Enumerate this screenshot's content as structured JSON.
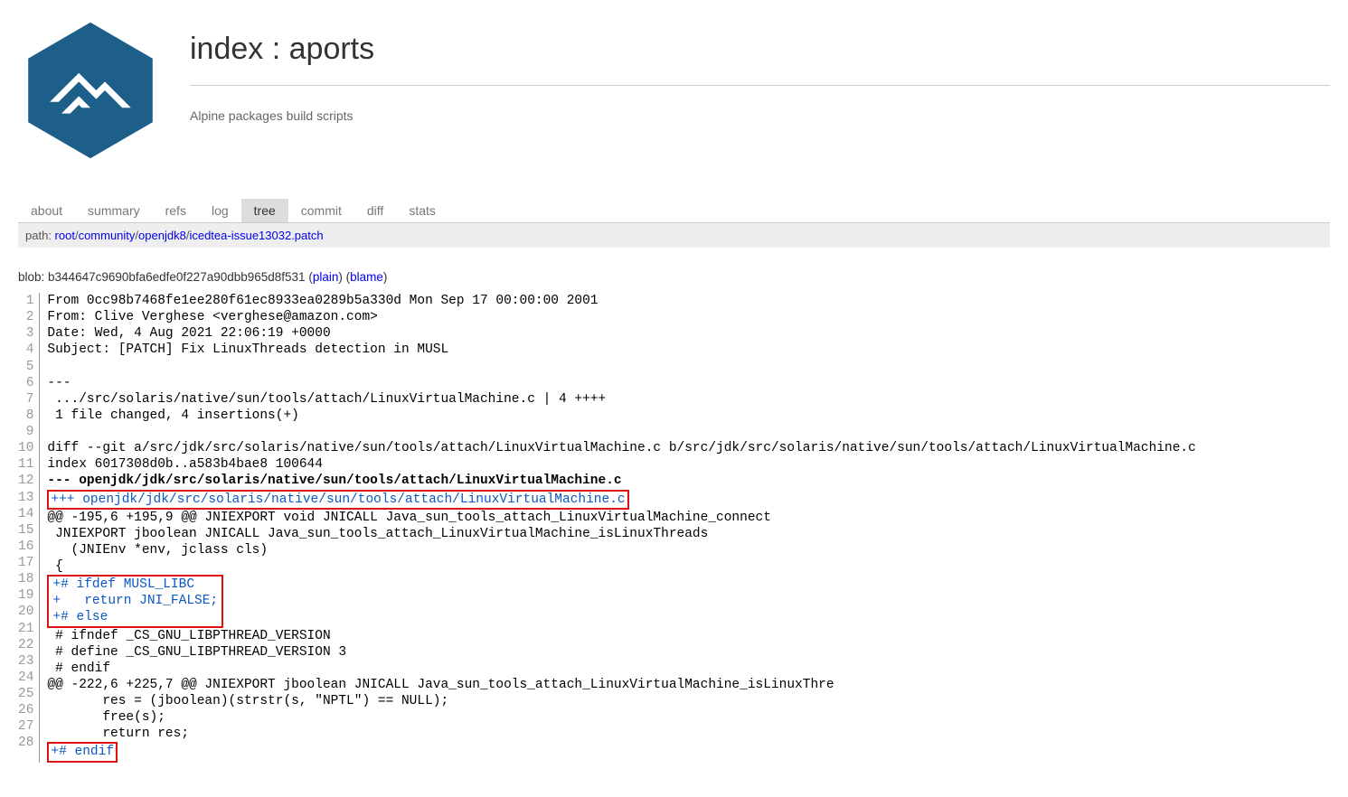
{
  "title": {
    "index": "index",
    "sep": " : ",
    "repo": "aports"
  },
  "repo_description": "Alpine packages build scripts",
  "tabs": [
    {
      "label": "about",
      "active": false
    },
    {
      "label": "summary",
      "active": false
    },
    {
      "label": "refs",
      "active": false
    },
    {
      "label": "log",
      "active": false
    },
    {
      "label": "tree",
      "active": true
    },
    {
      "label": "commit",
      "active": false
    },
    {
      "label": "diff",
      "active": false
    },
    {
      "label": "stats",
      "active": false
    }
  ],
  "path": {
    "label": "path: ",
    "segments": [
      "root",
      "community",
      "openjdk8",
      "icedtea-issue13032.patch"
    ]
  },
  "blob": {
    "prefix": "blob: ",
    "hash": "b344647c9690bfa6edfe0f227a90dbb965d8f531",
    "plain": "plain",
    "blame": "blame"
  },
  "code": {
    "lines": [
      {
        "n": 1,
        "t": "From 0cc98b7468fe1ee280f61ec8933ea0289b5a330d Mon Sep 17 00:00:00 2001",
        "cls": ""
      },
      {
        "n": 2,
        "t": "From: Clive Verghese <verghese@amazon.com>",
        "cls": ""
      },
      {
        "n": 3,
        "t": "Date: Wed, 4 Aug 2021 22:06:19 +0000",
        "cls": ""
      },
      {
        "n": 4,
        "t": "Subject: [PATCH] Fix LinuxThreads detection in MUSL",
        "cls": ""
      },
      {
        "n": 5,
        "t": "",
        "cls": ""
      },
      {
        "n": 6,
        "t": "---",
        "cls": ""
      },
      {
        "n": 7,
        "t": " .../src/solaris/native/sun/tools/attach/LinuxVirtualMachine.c | 4 ++++",
        "cls": ""
      },
      {
        "n": 8,
        "t": " 1 file changed, 4 insertions(+)",
        "cls": ""
      },
      {
        "n": 9,
        "t": "",
        "cls": ""
      },
      {
        "n": 10,
        "t": "diff --git a/src/jdk/src/solaris/native/sun/tools/attach/LinuxVirtualMachine.c b/src/jdk/src/solaris/native/sun/tools/attach/LinuxVirtualMachine.c",
        "cls": ""
      },
      {
        "n": 11,
        "t": "index 6017308d0b..a583b4bae8 100644",
        "cls": ""
      },
      {
        "n": 12,
        "t": "--- openjdk/jdk/src/solaris/native/sun/tools/attach/LinuxVirtualMachine.c",
        "cls": "hl-del"
      },
      {
        "n": 13,
        "t": "+++ openjdk/jdk/src/solaris/native/sun/tools/attach/LinuxVirtualMachine.c",
        "cls": "hl-add",
        "boxed": true
      },
      {
        "n": 14,
        "t": "@@ -195,6 +195,9 @@ JNIEXPORT void JNICALL Java_sun_tools_attach_LinuxVirtualMachine_connect",
        "cls": ""
      },
      {
        "n": 15,
        "t": " JNIEXPORT jboolean JNICALL Java_sun_tools_attach_LinuxVirtualMachine_isLinuxThreads",
        "cls": ""
      },
      {
        "n": 16,
        "t": "   (JNIEnv *env, jclass cls)",
        "cls": ""
      },
      {
        "n": 17,
        "t": " {",
        "cls": ""
      },
      {
        "n": 18,
        "t": "+# ifdef MUSL_LIBC",
        "cls": "hl-add",
        "boxgroup": "start"
      },
      {
        "n": 19,
        "t": "+   return JNI_FALSE;",
        "cls": "hl-add",
        "boxgroup": "mid"
      },
      {
        "n": 20,
        "t": "+# else",
        "cls": "hl-add",
        "boxgroup": "end"
      },
      {
        "n": 21,
        "t": " # ifndef _CS_GNU_LIBPTHREAD_VERSION",
        "cls": ""
      },
      {
        "n": 22,
        "t": " # define _CS_GNU_LIBPTHREAD_VERSION 3",
        "cls": ""
      },
      {
        "n": 23,
        "t": " # endif",
        "cls": ""
      },
      {
        "n": 24,
        "t": "@@ -222,6 +225,7 @@ JNIEXPORT jboolean JNICALL Java_sun_tools_attach_LinuxVirtualMachine_isLinuxThre",
        "cls": ""
      },
      {
        "n": 25,
        "t": "       res = (jboolean)(strstr(s, \"NPTL\") == NULL);",
        "cls": ""
      },
      {
        "n": 26,
        "t": "       free(s);",
        "cls": ""
      },
      {
        "n": 27,
        "t": "       return res;",
        "cls": ""
      },
      {
        "n": 28,
        "t": "+# endif",
        "cls": "hl-add",
        "boxed": true
      }
    ]
  }
}
